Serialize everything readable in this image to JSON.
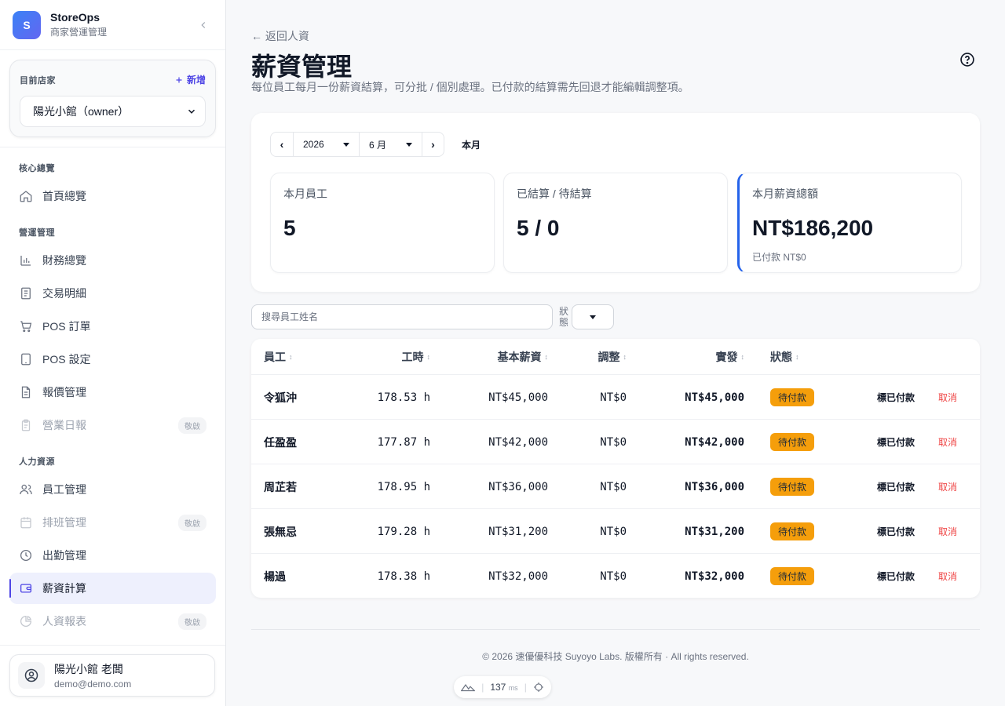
{
  "brand": {
    "logo_letter": "S",
    "name": "StoreOps",
    "subtitle": "商家營運管理"
  },
  "store": {
    "label": "目前店家",
    "add_label": "新增",
    "selected": "陽光小館（owner）"
  },
  "nav": {
    "sections": [
      {
        "title": "核心總覽",
        "items": [
          {
            "label": "首頁總覽",
            "icon": "home-icon"
          }
        ]
      },
      {
        "title": "營運管理",
        "items": [
          {
            "label": "財務總覽",
            "icon": "bar-chart-icon"
          },
          {
            "label": "交易明細",
            "icon": "list-doc-icon"
          },
          {
            "label": "POS 訂單",
            "icon": "cart-icon"
          },
          {
            "label": "POS 設定",
            "icon": "tablet-icon"
          },
          {
            "label": "報價管理",
            "icon": "document-icon"
          },
          {
            "label": "營業日報",
            "icon": "clipboard-icon",
            "badge": "敬啟"
          }
        ]
      },
      {
        "title": "人力資源",
        "items": [
          {
            "label": "員工管理",
            "icon": "users-icon"
          },
          {
            "label": "排班管理",
            "icon": "calendar-icon",
            "badge": "敬啟"
          },
          {
            "label": "出勤管理",
            "icon": "clock-icon"
          },
          {
            "label": "薪資計算",
            "icon": "wallet-icon"
          },
          {
            "label": "人資報表",
            "icon": "pie-chart-icon",
            "badge": "敬啟"
          }
        ]
      }
    ]
  },
  "user": {
    "name": "陽光小館 老闆",
    "email": "demo@demo.com"
  },
  "page": {
    "back": "← 返回人資",
    "title": "薪資管理",
    "description": "每位員工每月一份薪資結算，可分批 / 個別處理。已付款的結算需先回退才能編輯調整項。"
  },
  "period": {
    "prev": "‹",
    "year": "2026",
    "month": "6 月",
    "next": "›",
    "this_month": "本月"
  },
  "stats": [
    {
      "label": "本月員工",
      "value": "5",
      "sub": ""
    },
    {
      "label": "已結算 / 待結算",
      "value": "5 / 0",
      "sub": ""
    },
    {
      "label": "本月薪資總額",
      "value": "NT$186,200",
      "sub": "已付款 NT$0"
    }
  ],
  "filter": {
    "search_placeholder": "搜尋員工姓名",
    "status_label": "狀態"
  },
  "table": {
    "headers": {
      "employee": "員工",
      "hours": "工時",
      "base": "基本薪資",
      "adjust": "調整",
      "net": "實發",
      "status": "狀態"
    },
    "sort_glyph": "↕",
    "rows": [
      {
        "name": "令狐沖",
        "hours": "178.53 h",
        "base": "NT$45,000",
        "adjust": "NT$0",
        "net": "NT$45,000",
        "status": "待付款",
        "mark": "標已付款",
        "cancel": "取消"
      },
      {
        "name": "任盈盈",
        "hours": "177.87 h",
        "base": "NT$42,000",
        "adjust": "NT$0",
        "net": "NT$42,000",
        "status": "待付款",
        "mark": "標已付款",
        "cancel": "取消"
      },
      {
        "name": "周芷若",
        "hours": "178.95 h",
        "base": "NT$36,000",
        "adjust": "NT$0",
        "net": "NT$36,000",
        "status": "待付款",
        "mark": "標已付款",
        "cancel": "取消"
      },
      {
        "name": "張無忌",
        "hours": "179.28 h",
        "base": "NT$31,200",
        "adjust": "NT$0",
        "net": "NT$31,200",
        "status": "待付款",
        "mark": "標已付款",
        "cancel": "取消"
      },
      {
        "name": "楊過",
        "hours": "178.38 h",
        "base": "NT$32,000",
        "adjust": "NT$0",
        "net": "NT$32,000",
        "status": "待付款",
        "mark": "標已付款",
        "cancel": "取消"
      }
    ]
  },
  "footer": {
    "copyright": "© 2026 速優優科技 Suyoyo Labs. 版權所有 · All rights reserved."
  },
  "perf": {
    "value": "137",
    "unit": "ms"
  },
  "colors": {
    "accent": "#4f46e5",
    "stat_highlight": "#2563eb",
    "pending": "#f59e0b",
    "danger": "#ef4444"
  }
}
